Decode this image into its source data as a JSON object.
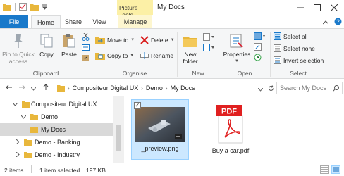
{
  "titlebar": {
    "context_tab_header": "Picture Tools",
    "window_title": "My Docs"
  },
  "tabs": {
    "file": "File",
    "home": "Home",
    "share": "Share",
    "view": "View",
    "manage": "Manage"
  },
  "ribbon": {
    "clipboard": {
      "label": "Clipboard",
      "pin": "Pin to Quick access",
      "copy": "Copy",
      "paste": "Paste"
    },
    "organise": {
      "label": "Organise",
      "move_to": "Move to",
      "copy_to": "Copy to",
      "delete": "Delete",
      "rename": "Rename"
    },
    "new": {
      "label": "New",
      "new_folder": "New folder"
    },
    "open": {
      "label": "Open",
      "properties": "Properties"
    },
    "select": {
      "label": "Select",
      "select_all": "Select all",
      "select_none": "Select none",
      "invert": "Invert selection"
    }
  },
  "address": {
    "crumbs": [
      "Compositeur Digital UX",
      "Demo",
      "My Docs"
    ],
    "search_placeholder": "Search My Docs"
  },
  "tree": [
    {
      "label": "Compositeur Digital UX",
      "expanded": true
    },
    {
      "label": "Demo",
      "expanded": true
    },
    {
      "label": "My Docs",
      "selected": true
    },
    {
      "label": "Demo - Banking",
      "expanded": false
    },
    {
      "label": "Demo - Industry",
      "expanded": false
    }
  ],
  "files": [
    {
      "name": "_preview.png",
      "selected": true,
      "icon": "image-thumbnail"
    },
    {
      "name": "Buy a car.pdf",
      "selected": false,
      "icon": "pdf-icon",
      "badge": "PDF"
    }
  ],
  "status": {
    "items": "2 items",
    "selected": "1 item selected",
    "size": "197 KB"
  },
  "colors": {
    "file_tab": "#1979ca",
    "context_tab": "#fcf0a6",
    "selection": "#cce8ff",
    "pdf_red": "#e02020"
  }
}
